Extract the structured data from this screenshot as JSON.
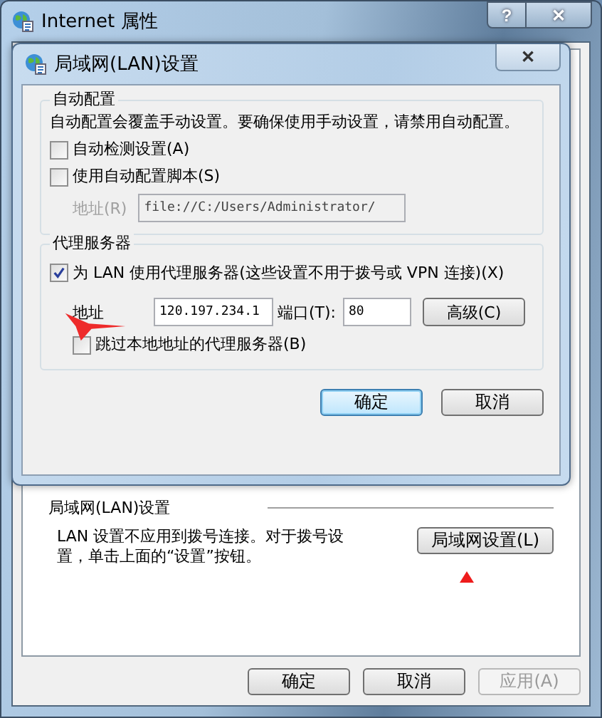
{
  "window": {
    "title": "Internet 属性",
    "help_button": "?",
    "close_button": "✕"
  },
  "lan_section": {
    "heading": "局域网(LAN)设置",
    "note": "LAN 设置不应用到拨号连接。对于拨号设置，单击上面的“设置”按钮。",
    "button": "局域网设置(L)"
  },
  "buttons": [
    {
      "label": "确定",
      "disabled": false
    },
    {
      "label": "取消",
      "disabled": false
    },
    {
      "label": "应用(A)",
      "disabled": true
    }
  ],
  "dialog": {
    "title": "局域网(LAN)设置",
    "close_button": "✕",
    "auto_config": {
      "heading": "自动配置",
      "description": "自动配置会覆盖手动设置。要确保使用手动设置，请禁用自动配置。",
      "checkboxes": [
        {
          "label": "自动检测设置(A)",
          "checked": false
        },
        {
          "label": "使用自动配置脚本(S)",
          "checked": false
        }
      ],
      "address": {
        "label": "地址(R)",
        "value": "file://C:/Users/Administrator/",
        "disabled": true
      }
    },
    "proxy": {
      "heading": "代理服务器",
      "use_proxy": {
        "label": "为 LAN 使用代理服务器(这些设置不用于拨号或 VPN 连接)(X)",
        "checked": true
      },
      "address": {
        "label": "地址",
        "value": "120.197.234.1"
      },
      "port": {
        "label": "端口(T):",
        "value": "80"
      },
      "advanced_button": "高级(C)",
      "bypass": {
        "label": "跳过本地地址的代理服务器(B)",
        "checked": false
      }
    },
    "buttons": [
      {
        "label": "确定",
        "default": true
      },
      {
        "label": "取消",
        "default": false
      }
    ]
  }
}
